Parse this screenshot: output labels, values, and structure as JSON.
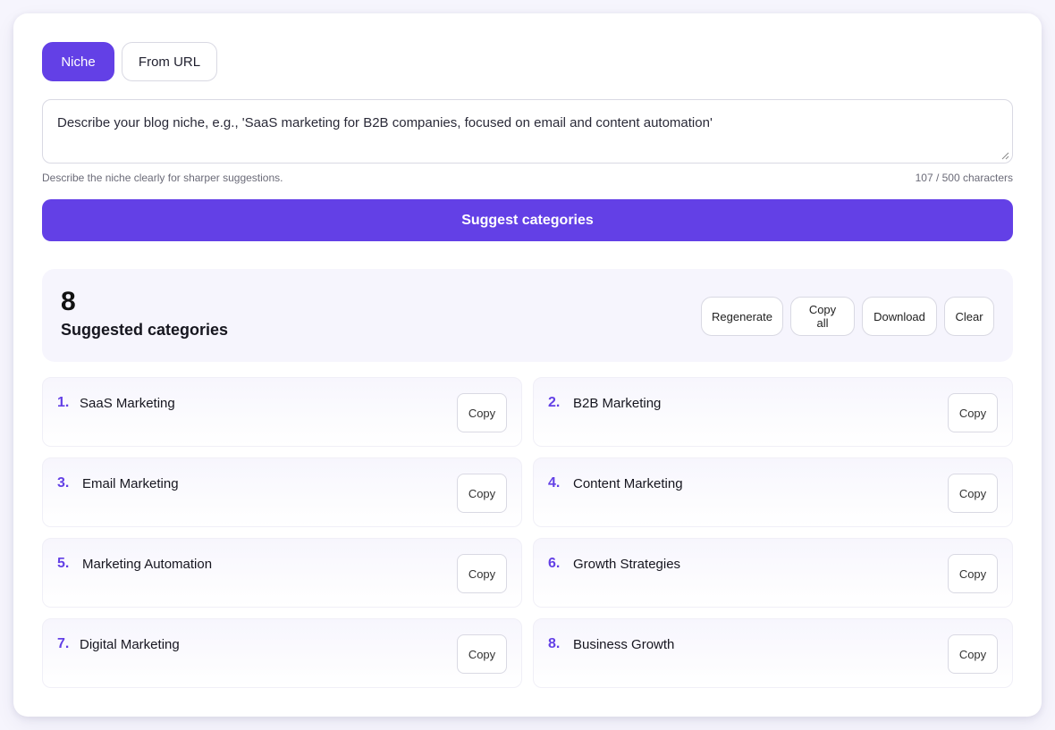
{
  "tabs": {
    "niche": "Niche",
    "from_url": "From URL"
  },
  "input": {
    "placeholder": "Describe your blog niche, e.g., 'SaaS marketing for B2B companies, focused on email and content automation'",
    "helper": "Describe the niche clearly for sharper suggestions.",
    "char_count": "107 / 500 characters"
  },
  "suggest_button": "Suggest categories",
  "summary": {
    "count": "8",
    "label": "Suggested categories",
    "regenerate": "Regenerate",
    "copy_all": "Copy all",
    "download": "Download",
    "clear": "Clear"
  },
  "categories": [
    {
      "num": "1.",
      "name": "SaaS Marketing",
      "copy": "Copy"
    },
    {
      "num": "2.",
      "name": "B2B Marketing",
      "copy": "Copy"
    },
    {
      "num": "3.",
      "name": "Email Marketing",
      "copy": "Copy"
    },
    {
      "num": "4.",
      "name": "Content Marketing",
      "copy": "Copy"
    },
    {
      "num": "5.",
      "name": "Marketing Automation",
      "copy": "Copy"
    },
    {
      "num": "6.",
      "name": "Growth Strategies",
      "copy": "Copy"
    },
    {
      "num": "7.",
      "name": "Digital Marketing",
      "copy": "Copy"
    },
    {
      "num": "8.",
      "name": "Business Growth",
      "copy": "Copy"
    }
  ],
  "colors": {
    "accent": "#6340e6",
    "panel": "#f6f5fd"
  }
}
